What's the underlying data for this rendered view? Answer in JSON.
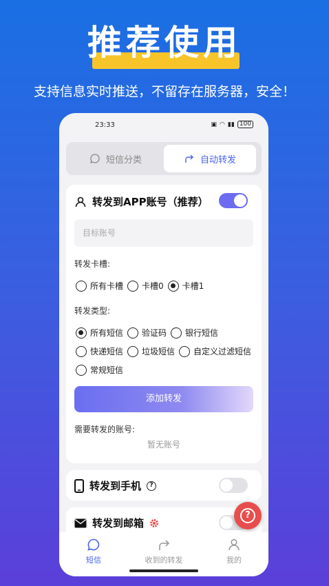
{
  "promo": {
    "headline": "推荐使用",
    "subline": "支持信息实时推送，不留存在服务器，安全！"
  },
  "statusbar": {
    "time": "23:33",
    "battery": "100"
  },
  "segmented": {
    "tabs": [
      {
        "label": "短信分类",
        "icon": "chat-bubble-icon",
        "active": false
      },
      {
        "label": "自动转发",
        "icon": "forward-arrow-icon",
        "active": true
      }
    ]
  },
  "forward_app": {
    "title": "转发到APP账号（推荐）",
    "enabled": true,
    "target_placeholder": "目标账号",
    "slot_label": "转发卡槽:",
    "slots": [
      "所有卡槽",
      "卡槽0",
      "卡槽1"
    ],
    "selected_slot": "卡槽1",
    "type_label": "转发类型:",
    "types": [
      "所有短信",
      "验证码",
      "银行短信",
      "快递短信",
      "垃圾短信",
      "自定义过滤短信",
      "常规短信"
    ],
    "selected_type": "所有短信",
    "add_button": "添加转发",
    "accounts_label": "需要转发的账号:",
    "empty_text": "暂无账号"
  },
  "forward_phone": {
    "title": "转发到手机",
    "enabled": false
  },
  "forward_email": {
    "title": "转发到邮箱",
    "enabled": false
  },
  "tabbar": {
    "items": [
      {
        "label": "短信",
        "icon": "chat-bubble-icon",
        "active": true
      },
      {
        "label": "收到的转发",
        "icon": "forward-arrow-icon",
        "active": false
      },
      {
        "label": "我的",
        "icon": "person-icon",
        "active": false
      }
    ]
  },
  "colors": {
    "accent": "#4a63e8",
    "toggle_on": "#6b6cf0",
    "fab": "#e84d4d",
    "highlight": "#f7c52a"
  }
}
